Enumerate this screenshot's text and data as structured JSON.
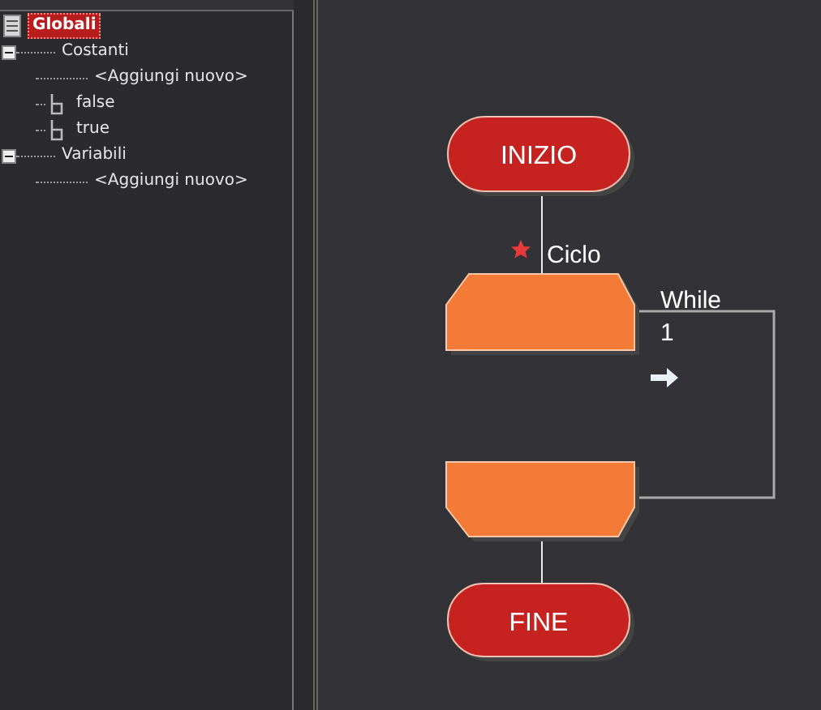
{
  "tree": [
    {
      "label": "Globali",
      "selected": true,
      "children": [
        {
          "label": "Costanti",
          "selected": false,
          "expanded": true,
          "children": [
            {
              "label": "<Aggiungi nuovo>",
              "selected": false,
              "kind": "add"
            },
            {
              "label": "false",
              "selected": false,
              "kind": "bool"
            },
            {
              "label": "true",
              "selected": false,
              "kind": "bool"
            }
          ]
        },
        {
          "label": "Variabili",
          "selected": false,
          "expanded": true,
          "children": [
            {
              "label": "<Aggiungi nuovo>",
              "selected": false,
              "kind": "add"
            }
          ]
        }
      ]
    }
  ],
  "flowchart": {
    "start": "INIZIO",
    "loop_label": "Ciclo",
    "loop_type": "While",
    "loop_condition": "1",
    "end": "FINE"
  }
}
